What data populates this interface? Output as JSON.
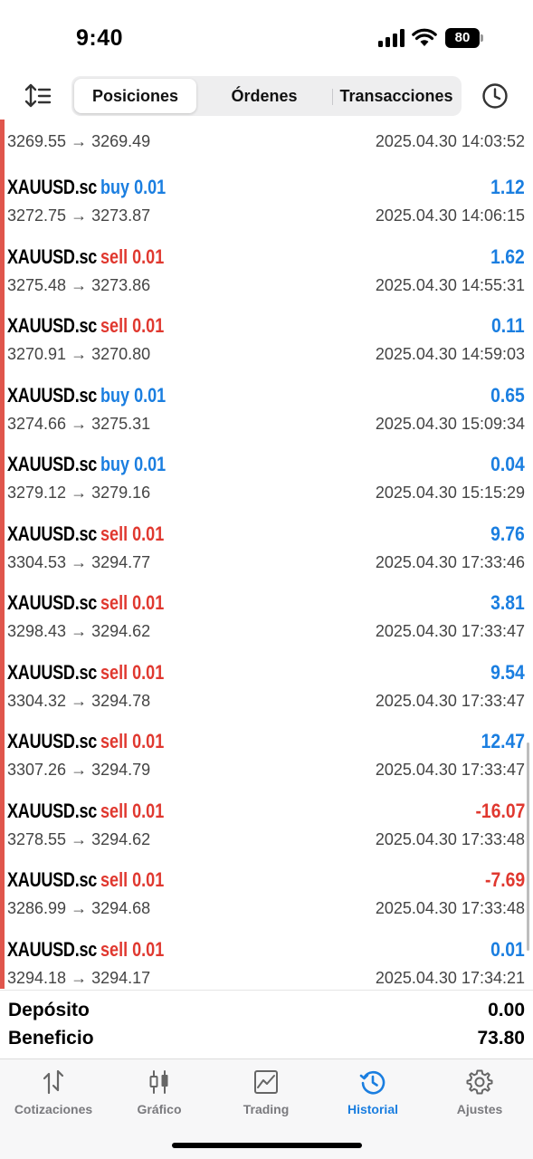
{
  "status_bar": {
    "time": "9:40",
    "battery": "80"
  },
  "toolbar": {
    "sort_icon": "sort-icon",
    "tabs": [
      {
        "label": "Posiciones",
        "active": true
      },
      {
        "label": "Órdenes",
        "active": false
      },
      {
        "label": "Transacciones",
        "active": false
      }
    ],
    "history_icon": "clock-icon"
  },
  "deals": [
    {
      "symbol": "",
      "side": "",
      "volume": "",
      "profit": "",
      "prices": "3269.55 → 3269.49",
      "datetime": "2025.04.30 14:03:52"
    },
    {
      "symbol": "XAUUSD.sc",
      "side": "buy",
      "volume": "0.01",
      "profit": "1.12",
      "prices": "3272.75 → 3273.87",
      "datetime": "2025.04.30 14:06:15"
    },
    {
      "symbol": "XAUUSD.sc",
      "side": "sell",
      "volume": "0.01",
      "profit": "1.62",
      "prices": "3275.48 → 3273.86",
      "datetime": "2025.04.30 14:55:31"
    },
    {
      "symbol": "XAUUSD.sc",
      "side": "sell",
      "volume": "0.01",
      "profit": "0.11",
      "prices": "3270.91 → 3270.80",
      "datetime": "2025.04.30 14:59:03"
    },
    {
      "symbol": "XAUUSD.sc",
      "side": "buy",
      "volume": "0.01",
      "profit": "0.65",
      "prices": "3274.66 → 3275.31",
      "datetime": "2025.04.30 15:09:34"
    },
    {
      "symbol": "XAUUSD.sc",
      "side": "buy",
      "volume": "0.01",
      "profit": "0.04",
      "prices": "3279.12 → 3279.16",
      "datetime": "2025.04.30 15:15:29"
    },
    {
      "symbol": "XAUUSD.sc",
      "side": "sell",
      "volume": "0.01",
      "profit": "9.76",
      "prices": "3304.53 → 3294.77",
      "datetime": "2025.04.30 17:33:46"
    },
    {
      "symbol": "XAUUSD.sc",
      "side": "sell",
      "volume": "0.01",
      "profit": "3.81",
      "prices": "3298.43 → 3294.62",
      "datetime": "2025.04.30 17:33:47"
    },
    {
      "symbol": "XAUUSD.sc",
      "side": "sell",
      "volume": "0.01",
      "profit": "9.54",
      "prices": "3304.32 → 3294.78",
      "datetime": "2025.04.30 17:33:47"
    },
    {
      "symbol": "XAUUSD.sc",
      "side": "sell",
      "volume": "0.01",
      "profit": "12.47",
      "prices": "3307.26 → 3294.79",
      "datetime": "2025.04.30 17:33:47"
    },
    {
      "symbol": "XAUUSD.sc",
      "side": "sell",
      "volume": "0.01",
      "profit": "-16.07",
      "prices": "3278.55 → 3294.62",
      "datetime": "2025.04.30 17:33:48"
    },
    {
      "symbol": "XAUUSD.sc",
      "side": "sell",
      "volume": "0.01",
      "profit": "-7.69",
      "prices": "3286.99 → 3294.68",
      "datetime": "2025.04.30 17:33:48"
    },
    {
      "symbol": "XAUUSD.sc",
      "side": "sell",
      "volume": "0.01",
      "profit": "0.01",
      "prices": "3294.18 → 3294.17",
      "datetime": "2025.04.30 17:34:21"
    }
  ],
  "summary": {
    "deposit_label": "Depósito",
    "deposit_value": "0.00",
    "profit_label": "Beneficio",
    "profit_value": "73.80"
  },
  "tabbar": [
    {
      "label": "Cotizaciones",
      "icon": "quotes-icon",
      "active": false
    },
    {
      "label": "Gráfico",
      "icon": "chart-icon",
      "active": false
    },
    {
      "label": "Trading",
      "icon": "trading-icon",
      "active": false
    },
    {
      "label": "Historial",
      "icon": "history-icon",
      "active": true
    },
    {
      "label": "Ajustes",
      "icon": "settings-icon",
      "active": false
    }
  ],
  "colors": {
    "accent": "#1a7ee0",
    "sell": "#e0382f",
    "marker": "#e0564c"
  }
}
